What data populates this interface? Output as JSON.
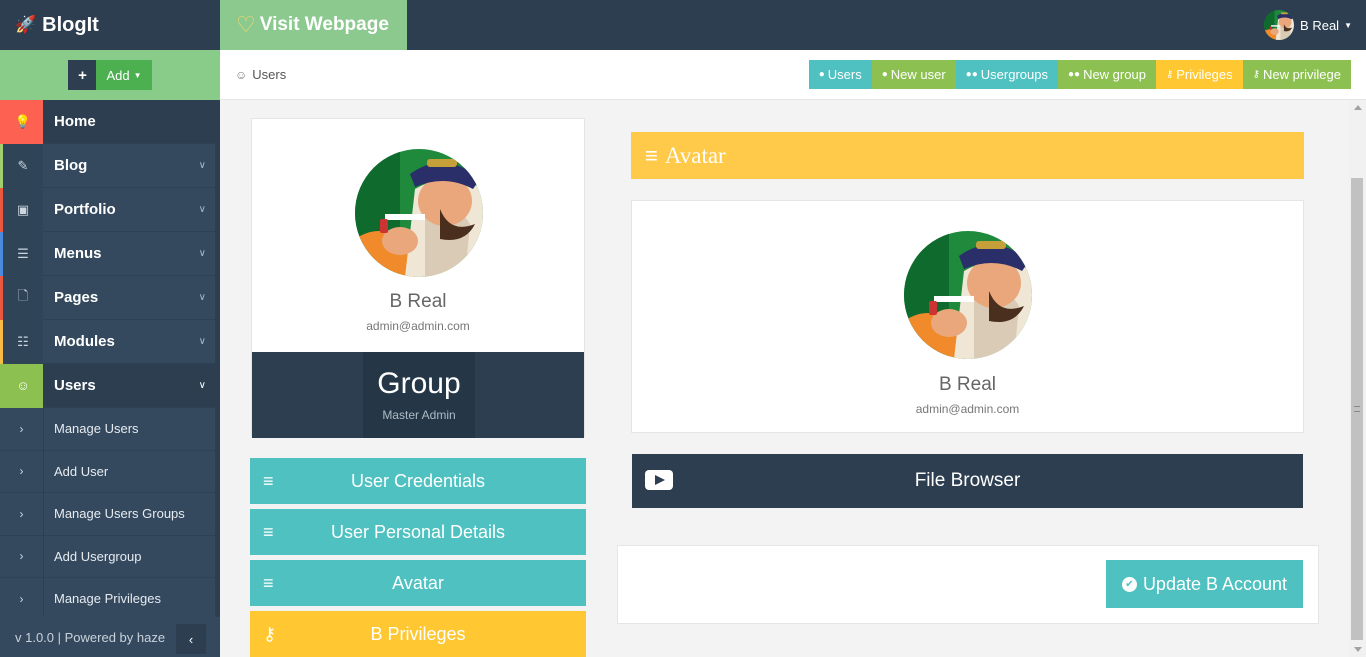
{
  "brand": {
    "name": "BlogIt",
    "icon": "rocket-icon"
  },
  "add_bar": {
    "plus": "+",
    "label": "Add"
  },
  "sidebar": {
    "items": [
      {
        "label": "Home",
        "icon": "lightbulb-icon"
      },
      {
        "label": "Blog",
        "icon": "edit-icon"
      },
      {
        "label": "Portfolio",
        "icon": "briefcase-icon"
      },
      {
        "label": "Menus",
        "icon": "list-icon"
      },
      {
        "label": "Pages",
        "icon": "file-icon"
      },
      {
        "label": "Modules",
        "icon": "sitemap-icon"
      },
      {
        "label": "Users",
        "icon": "users-icon"
      }
    ],
    "sub_items": [
      {
        "label": "Manage Users"
      },
      {
        "label": "Add User"
      },
      {
        "label": "Manage Users Groups"
      },
      {
        "label": "Add Usergroup"
      },
      {
        "label": "Manage Privileges"
      }
    ],
    "footer": "v 1.0.0 | Powered by haze"
  },
  "topbar": {
    "visit_label": "Visit Webpage",
    "user_name": "B Real"
  },
  "breadcrumb": {
    "label": "Users"
  },
  "actions": [
    {
      "label": "Users",
      "color": "#4fc1c1"
    },
    {
      "label": "New user",
      "color": "#8cc152"
    },
    {
      "label": "Usergroups",
      "color": "#4fc1c1"
    },
    {
      "label": "New group",
      "color": "#8cc152"
    },
    {
      "label": "Privileges",
      "color": "#ffc832"
    },
    {
      "label": "New privilege",
      "color": "#8cc152"
    }
  ],
  "profile": {
    "name": "B Real",
    "email": "admin@admin.com",
    "group_title": "Group",
    "group_name": "Master Admin"
  },
  "side_buttons": [
    {
      "label": "User Credentials",
      "color": "#4fc1c1"
    },
    {
      "label": "User Personal Details",
      "color": "#4fc1c1"
    },
    {
      "label": "Avatar",
      "color": "#4fc1c1"
    },
    {
      "label": "B Privileges",
      "color": "#ffc832"
    }
  ],
  "avatar_panel": {
    "title": "Avatar",
    "name": "B Real",
    "email": "admin@admin.com",
    "file_browser": "File Browser"
  },
  "update_button": "Update B Account"
}
